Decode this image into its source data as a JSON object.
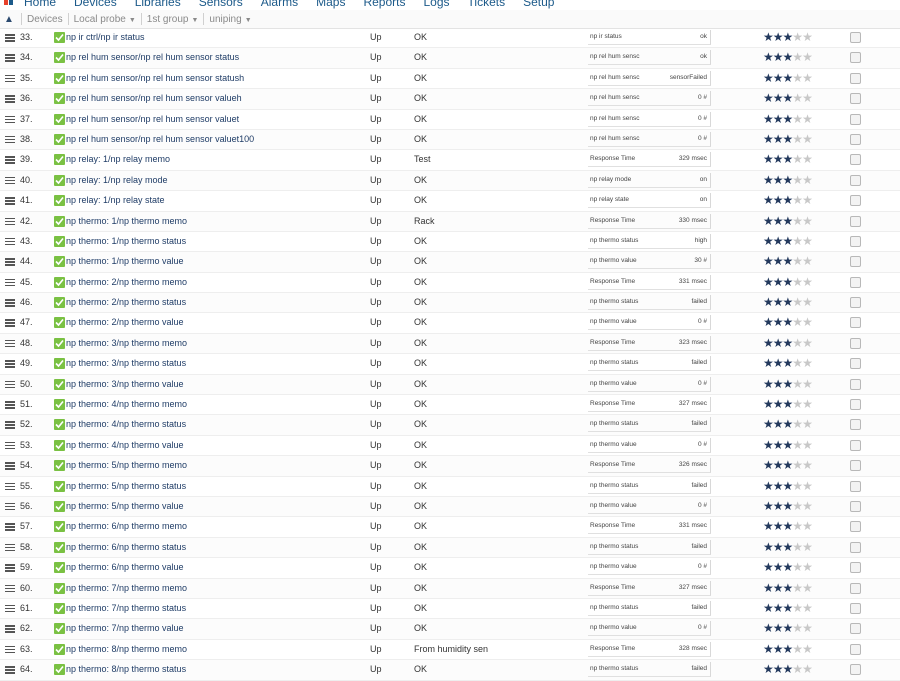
{
  "nav": {
    "items": [
      "Home",
      "Devices",
      "Libraries",
      "Sensors",
      "Alarms",
      "Maps",
      "Reports",
      "Logs",
      "Tickets",
      "Setup"
    ]
  },
  "breadcrumb": {
    "home_icon": "home-icon",
    "devices": "Devices",
    "probe": "Local probe",
    "group": "1st group",
    "device": "uniping"
  },
  "colors": {
    "link": "#1f3c66",
    "ok_check": "#7ac143",
    "star_on": "#23395d",
    "star_off": "#c8c8c8"
  },
  "rows": [
    {
      "num": "33.",
      "name": "np ir ctrl/np ir status",
      "status": "Up",
      "message": "OK",
      "channel": "np ir status",
      "value": "ok",
      "priority": 3
    },
    {
      "num": "34.",
      "name": "np rel hum sensor/np rel hum sensor status",
      "status": "Up",
      "message": "OK",
      "channel": "np rel hum sensc",
      "value": "ok",
      "priority": 3
    },
    {
      "num": "35.",
      "name": "np rel hum sensor/np rel hum sensor statush",
      "status": "Up",
      "message": "OK",
      "channel": "np rel hum sensc",
      "value": "sensorFailed",
      "priority": 3
    },
    {
      "num": "36.",
      "name": "np rel hum sensor/np rel hum sensor valueh",
      "status": "Up",
      "message": "OK",
      "channel": "np rel hum sensc",
      "value": "0 #",
      "priority": 3
    },
    {
      "num": "37.",
      "name": "np rel hum sensor/np rel hum sensor valuet",
      "status": "Up",
      "message": "OK",
      "channel": "np rel hum sensc",
      "value": "0 #",
      "priority": 3
    },
    {
      "num": "38.",
      "name": "np rel hum sensor/np rel hum sensor valuet100",
      "status": "Up",
      "message": "OK",
      "channel": "np rel hum sensc",
      "value": "0 #",
      "priority": 3
    },
    {
      "num": "39.",
      "name": "np relay: 1/np relay memo",
      "status": "Up",
      "message": "Test",
      "channel": "Response Time",
      "value": "329 msec",
      "priority": 3
    },
    {
      "num": "40.",
      "name": "np relay: 1/np relay mode",
      "status": "Up",
      "message": "OK",
      "channel": "np relay mode",
      "value": "on",
      "priority": 3
    },
    {
      "num": "41.",
      "name": "np relay: 1/np relay state",
      "status": "Up",
      "message": "OK",
      "channel": "np relay state",
      "value": "on",
      "priority": 3
    },
    {
      "num": "42.",
      "name": "np thermo: 1/np thermo memo",
      "status": "Up",
      "message": "Rack",
      "channel": "Response Time",
      "value": "330 msec",
      "priority": 3
    },
    {
      "num": "43.",
      "name": "np thermo: 1/np thermo status",
      "status": "Up",
      "message": "OK",
      "channel": "np thermo status",
      "value": "high",
      "priority": 3
    },
    {
      "num": "44.",
      "name": "np thermo: 1/np thermo value",
      "status": "Up",
      "message": "OK",
      "channel": "np thermo value",
      "value": "30 #",
      "priority": 3
    },
    {
      "num": "45.",
      "name": "np thermo: 2/np thermo memo",
      "status": "Up",
      "message": "OK",
      "channel": "Response Time",
      "value": "331 msec",
      "priority": 3
    },
    {
      "num": "46.",
      "name": "np thermo: 2/np thermo status",
      "status": "Up",
      "message": "OK",
      "channel": "np thermo status",
      "value": "failed",
      "priority": 3
    },
    {
      "num": "47.",
      "name": "np thermo: 2/np thermo value",
      "status": "Up",
      "message": "OK",
      "channel": "np thermo value",
      "value": "0 #",
      "priority": 3
    },
    {
      "num": "48.",
      "name": "np thermo: 3/np thermo memo",
      "status": "Up",
      "message": "OK",
      "channel": "Response Time",
      "value": "323 msec",
      "priority": 3
    },
    {
      "num": "49.",
      "name": "np thermo: 3/np thermo status",
      "status": "Up",
      "message": "OK",
      "channel": "np thermo status",
      "value": "failed",
      "priority": 3
    },
    {
      "num": "50.",
      "name": "np thermo: 3/np thermo value",
      "status": "Up",
      "message": "OK",
      "channel": "np thermo value",
      "value": "0 #",
      "priority": 3
    },
    {
      "num": "51.",
      "name": "np thermo: 4/np thermo memo",
      "status": "Up",
      "message": "OK",
      "channel": "Response Time",
      "value": "327 msec",
      "priority": 3
    },
    {
      "num": "52.",
      "name": "np thermo: 4/np thermo status",
      "status": "Up",
      "message": "OK",
      "channel": "np thermo status",
      "value": "failed",
      "priority": 3
    },
    {
      "num": "53.",
      "name": "np thermo: 4/np thermo value",
      "status": "Up",
      "message": "OK",
      "channel": "np thermo value",
      "value": "0 #",
      "priority": 3
    },
    {
      "num": "54.",
      "name": "np thermo: 5/np thermo memo",
      "status": "Up",
      "message": "OK",
      "channel": "Response Time",
      "value": "326 msec",
      "priority": 3
    },
    {
      "num": "55.",
      "name": "np thermo: 5/np thermo status",
      "status": "Up",
      "message": "OK",
      "channel": "np thermo status",
      "value": "failed",
      "priority": 3
    },
    {
      "num": "56.",
      "name": "np thermo: 5/np thermo value",
      "status": "Up",
      "message": "OK",
      "channel": "np thermo value",
      "value": "0 #",
      "priority": 3
    },
    {
      "num": "57.",
      "name": "np thermo: 6/np thermo memo",
      "status": "Up",
      "message": "OK",
      "channel": "Response Time",
      "value": "331 msec",
      "priority": 3
    },
    {
      "num": "58.",
      "name": "np thermo: 6/np thermo status",
      "status": "Up",
      "message": "OK",
      "channel": "np thermo status",
      "value": "failed",
      "priority": 3
    },
    {
      "num": "59.",
      "name": "np thermo: 6/np thermo value",
      "status": "Up",
      "message": "OK",
      "channel": "np thermo value",
      "value": "0 #",
      "priority": 3
    },
    {
      "num": "60.",
      "name": "np thermo: 7/np thermo memo",
      "status": "Up",
      "message": "OK",
      "channel": "Response Time",
      "value": "327 msec",
      "priority": 3
    },
    {
      "num": "61.",
      "name": "np thermo: 7/np thermo status",
      "status": "Up",
      "message": "OK",
      "channel": "np thermo status",
      "value": "failed",
      "priority": 3
    },
    {
      "num": "62.",
      "name": "np thermo: 7/np thermo value",
      "status": "Up",
      "message": "OK",
      "channel": "np thermo value",
      "value": "0 #",
      "priority": 3
    },
    {
      "num": "63.",
      "name": "np thermo: 8/np thermo memo",
      "status": "Up",
      "message": "From humidity sen",
      "channel": "Response Time",
      "value": "328 msec",
      "priority": 3
    },
    {
      "num": "64.",
      "name": "np thermo: 8/np thermo status",
      "status": "Up",
      "message": "OK",
      "channel": "np thermo status",
      "value": "failed",
      "priority": 3
    }
  ]
}
